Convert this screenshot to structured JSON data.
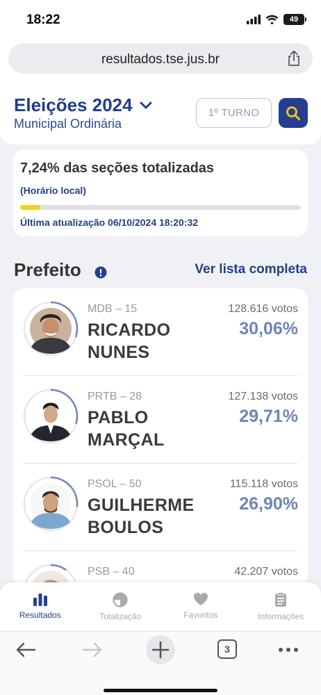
{
  "status_bar": {
    "time": "18:22",
    "battery": "49"
  },
  "browser": {
    "url": "resultados.tse.jus.br",
    "tab_count": "3"
  },
  "header": {
    "title": "Eleições 2024",
    "subtitle": "Municipal Ordinária",
    "turno_label": "1º TURNO"
  },
  "progress": {
    "percent_text": "7,24% das seções totalizadas",
    "percent_value": 7.24,
    "local_time_label": "(Horário local)",
    "last_update": "Última atualização 06/10/2024 18:20:32"
  },
  "section": {
    "title": "Prefeito",
    "see_all": "Ver lista completa"
  },
  "candidates": [
    {
      "party": "MDB – 15",
      "name_line1": "RICARDO",
      "name_line2": "NUNES",
      "votes": "128.616 votos",
      "percent": "30,06%",
      "arc": 30.06
    },
    {
      "party": "PRTB – 28",
      "name_line1": "PABLO",
      "name_line2": "MARÇAL",
      "votes": "127.138 votos",
      "percent": "29,71%",
      "arc": 29.71
    },
    {
      "party": "PSOL – 50",
      "name_line1": "GUILHERME",
      "name_line2": "BOULOS",
      "votes": "115.118 votos",
      "percent": "26,90%",
      "arc": 26.9
    },
    {
      "party": "PSB – 40",
      "name_line1": "",
      "name_line2": "",
      "votes": "42.207 votos",
      "percent": "",
      "arc": 9.86
    }
  ],
  "bottom_nav": [
    {
      "label": "Resultados",
      "icon": "bar-chart-icon",
      "active": true
    },
    {
      "label": "Totalização",
      "icon": "pie-icon",
      "active": false
    },
    {
      "label": "Favoritos",
      "icon": "heart-icon",
      "active": false
    },
    {
      "label": "Informações",
      "icon": "document-icon",
      "active": false
    }
  ],
  "colors": {
    "brand_blue": "#243f8f",
    "progress_yellow": "#f2d21a",
    "percent_blue": "#6e85b8"
  }
}
